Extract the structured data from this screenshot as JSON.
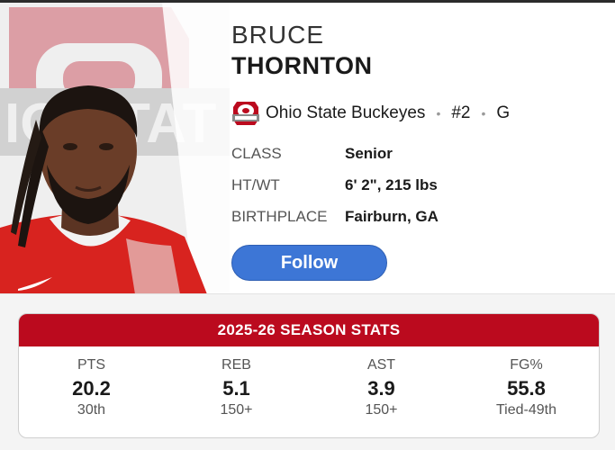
{
  "player": {
    "first_name": "BRUCE",
    "last_name": "THORNTON",
    "team": "Ohio State Buckeyes",
    "number": "#2",
    "position": "G",
    "separator": "•"
  },
  "info": [
    {
      "label": "CLASS",
      "value": "Senior"
    },
    {
      "label": "HT/WT",
      "value": "6' 2\", 215 lbs"
    },
    {
      "label": "BIRTHPLACE",
      "value": "Fairburn, GA"
    }
  ],
  "follow_label": "Follow",
  "stats": {
    "title": "2025-26 SEASON STATS",
    "items": [
      {
        "label": "PTS",
        "value": "20.2",
        "rank": "30th"
      },
      {
        "label": "REB",
        "value": "5.1",
        "rank": "150+"
      },
      {
        "label": "AST",
        "value": "3.9",
        "rank": "150+"
      },
      {
        "label": "FG%",
        "value": "55.8",
        "rank": "Tied-49th"
      }
    ]
  },
  "colors": {
    "team_red": "#bb0a1e",
    "follow_blue": "#3d76d6"
  },
  "icons": {
    "team_logo": "ohio-state-block-o-logo",
    "photo": "player-headshot"
  }
}
